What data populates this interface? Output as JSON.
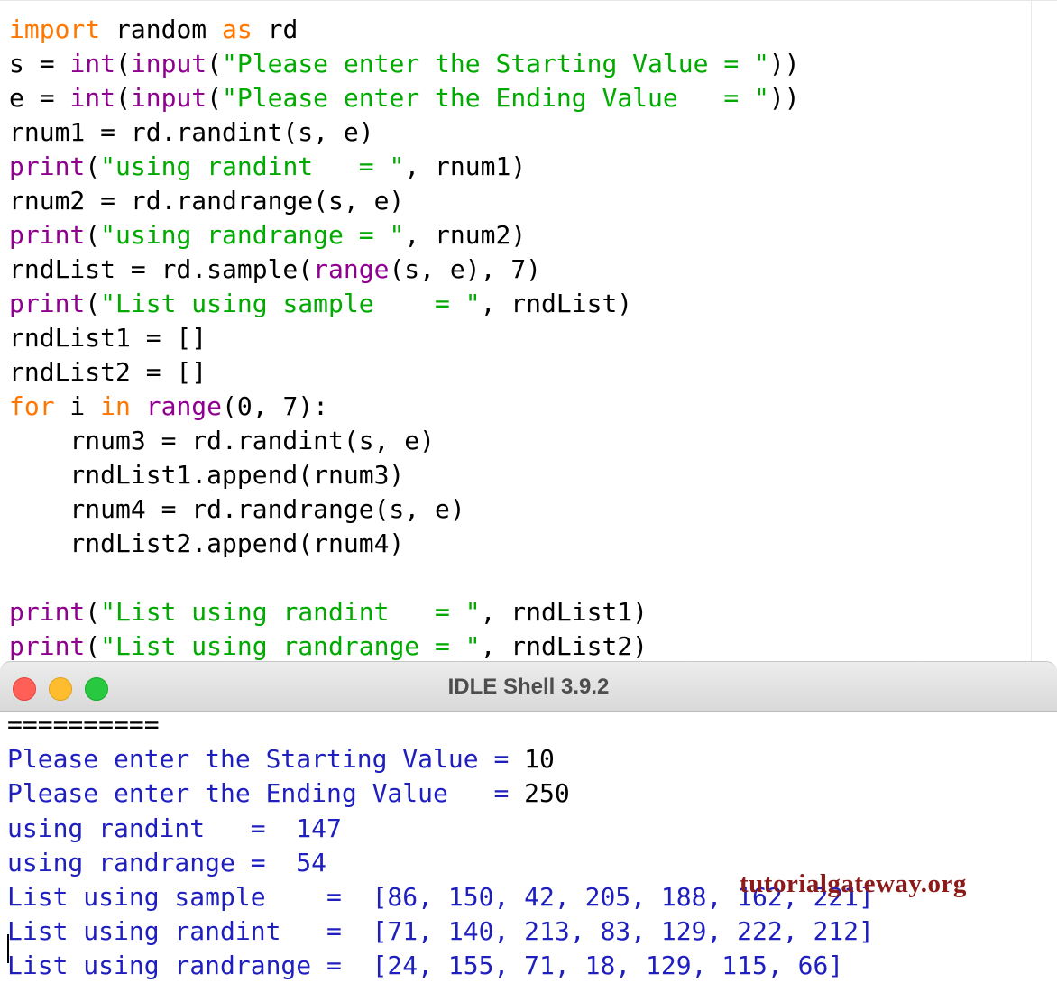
{
  "editor": {
    "lines": [
      [
        {
          "t": "import",
          "c": "kw"
        },
        {
          "t": " random ",
          "c": "plain"
        },
        {
          "t": "as",
          "c": "kw"
        },
        {
          "t": " rd",
          "c": "plain"
        }
      ],
      [
        {
          "t": "s = ",
          "c": "plain"
        },
        {
          "t": "int",
          "c": "blt"
        },
        {
          "t": "(",
          "c": "plain"
        },
        {
          "t": "input",
          "c": "blt"
        },
        {
          "t": "(",
          "c": "plain"
        },
        {
          "t": "\"Please enter the Starting Value = \"",
          "c": "str"
        },
        {
          "t": "))",
          "c": "plain"
        }
      ],
      [
        {
          "t": "e = ",
          "c": "plain"
        },
        {
          "t": "int",
          "c": "blt"
        },
        {
          "t": "(",
          "c": "plain"
        },
        {
          "t": "input",
          "c": "blt"
        },
        {
          "t": "(",
          "c": "plain"
        },
        {
          "t": "\"Please enter the Ending Value   = \"",
          "c": "str"
        },
        {
          "t": "))",
          "c": "plain"
        }
      ],
      [
        {
          "t": "rnum1 = rd.randint(s, e)",
          "c": "plain"
        }
      ],
      [
        {
          "t": "print",
          "c": "blt"
        },
        {
          "t": "(",
          "c": "plain"
        },
        {
          "t": "\"using randint   = \"",
          "c": "str"
        },
        {
          "t": ", rnum1)",
          "c": "plain"
        }
      ],
      [
        {
          "t": "rnum2 = rd.randrange(s, e)",
          "c": "plain"
        }
      ],
      [
        {
          "t": "print",
          "c": "blt"
        },
        {
          "t": "(",
          "c": "plain"
        },
        {
          "t": "\"using randrange = \"",
          "c": "str"
        },
        {
          "t": ", rnum2)",
          "c": "plain"
        }
      ],
      [
        {
          "t": "rndList = rd.sample(",
          "c": "plain"
        },
        {
          "t": "range",
          "c": "blt"
        },
        {
          "t": "(s, e), 7)",
          "c": "plain"
        }
      ],
      [
        {
          "t": "print",
          "c": "blt"
        },
        {
          "t": "(",
          "c": "plain"
        },
        {
          "t": "\"List using sample    = \"",
          "c": "str"
        },
        {
          "t": ", rndList)",
          "c": "plain"
        }
      ],
      [
        {
          "t": "rndList1 = []",
          "c": "plain"
        }
      ],
      [
        {
          "t": "rndList2 = []",
          "c": "plain"
        }
      ],
      [
        {
          "t": "for",
          "c": "kw"
        },
        {
          "t": " i ",
          "c": "plain"
        },
        {
          "t": "in",
          "c": "kw"
        },
        {
          "t": " ",
          "c": "plain"
        },
        {
          "t": "range",
          "c": "blt"
        },
        {
          "t": "(0, 7):",
          "c": "plain"
        }
      ],
      [
        {
          "t": "    rnum3 = rd.randint(s, e)",
          "c": "plain"
        }
      ],
      [
        {
          "t": "    rndList1.append(rnum3)",
          "c": "plain"
        }
      ],
      [
        {
          "t": "    rnum4 = rd.randrange(s, e)",
          "c": "plain"
        }
      ],
      [
        {
          "t": "    rndList2.append(rnum4)",
          "c": "plain"
        }
      ],
      [
        {
          "t": "",
          "c": "plain"
        }
      ],
      [
        {
          "t": "print",
          "c": "blt"
        },
        {
          "t": "(",
          "c": "plain"
        },
        {
          "t": "\"List using randint   = \"",
          "c": "str"
        },
        {
          "t": ", rndList1)",
          "c": "plain"
        }
      ],
      [
        {
          "t": "print",
          "c": "blt"
        },
        {
          "t": "(",
          "c": "plain"
        },
        {
          "t": "\"List using randrange = \"",
          "c": "str"
        },
        {
          "t": ", rndList2)",
          "c": "plain"
        }
      ]
    ]
  },
  "shell": {
    "title": "IDLE Shell 3.9.2",
    "lines": [
      [
        {
          "t": "==========",
          "c": "sep"
        }
      ],
      [
        {
          "t": "Please enter the Starting Value = ",
          "c": "out"
        },
        {
          "t": "10",
          "c": "inp"
        }
      ],
      [
        {
          "t": "Please enter the Ending Value   = ",
          "c": "out"
        },
        {
          "t": "250",
          "c": "inp"
        }
      ],
      [
        {
          "t": "using randint   =  147",
          "c": "out"
        }
      ],
      [
        {
          "t": "using randrange =  54",
          "c": "out"
        }
      ],
      [
        {
          "t": "List using sample    =  [86, 150, 42, 205, 188, 162, 221]",
          "c": "out"
        }
      ],
      [
        {
          "t": "List using randint   =  [71, 140, 213, 83, 129, 222, 212]",
          "c": "out"
        }
      ],
      [
        {
          "t": "List using randrange =  [24, 155, 71, 18, 129, 115, 66]",
          "c": "out"
        }
      ]
    ],
    "watermark": "tutorialgateway.org"
  }
}
